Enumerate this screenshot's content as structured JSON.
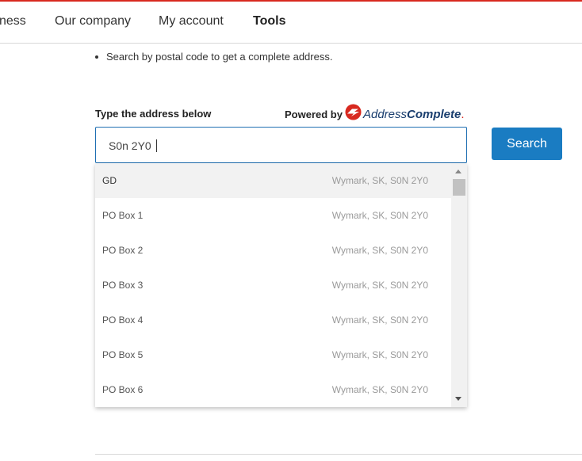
{
  "nav": {
    "items": [
      "ness",
      "Our company",
      "My account",
      "Tools"
    ]
  },
  "bullet_text": "Search by postal code to get a complete address.",
  "form": {
    "label": "Type the address below",
    "powered_by": "Powered by",
    "brand_part1": "Address",
    "brand_part2": "Complete",
    "brand_dot": ".",
    "input_value": "S0n 2Y0",
    "search_button": "Search"
  },
  "suggestions": [
    {
      "name": "GD",
      "location": "Wymark, SK, S0N 2Y0"
    },
    {
      "name": "PO Box 1",
      "location": "Wymark, SK, S0N 2Y0"
    },
    {
      "name": "PO Box 2",
      "location": "Wymark, SK, S0N 2Y0"
    },
    {
      "name": "PO Box 3",
      "location": "Wymark, SK, S0N 2Y0"
    },
    {
      "name": "PO Box 4",
      "location": "Wymark, SK, S0N 2Y0"
    },
    {
      "name": "PO Box 5",
      "location": "Wymark, SK, S0N 2Y0"
    },
    {
      "name": "PO Box 6",
      "location": "Wymark, SK, S0N 2Y0"
    }
  ],
  "colors": {
    "brand_red": "#d8291f",
    "button_blue": "#1a7cc2",
    "input_border": "#1f6fb2",
    "logo_navy": "#1a3e6e"
  }
}
